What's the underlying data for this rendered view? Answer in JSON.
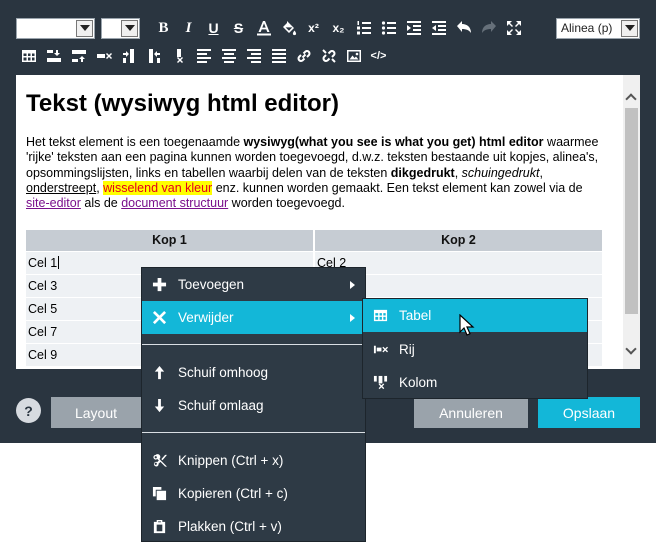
{
  "toolbar": {
    "format_select": {
      "value": "Alinea (p)"
    },
    "font_select": {
      "value": ""
    },
    "size_select": {
      "value": ""
    },
    "bold_label": "B",
    "italic_label": "I",
    "underline_label": "U",
    "strike_label": "S",
    "superscript_label": "x²",
    "subscript_label": "x₂",
    "source_label": "</>"
  },
  "editor": {
    "heading": "Tekst (wysiwyg html editor)",
    "para": {
      "t1": "Het tekst element is een toegenaamde ",
      "b1": "wysiwyg(what you see is what you get) html editor",
      "t2": " waarmee 'rijke' teksten aan een pagina kunnen worden toegevoegd, d.w.z. teksten bestaande uit kopjes, alinea's, opsommingslijsten, links en tabellen waarbij delen van de teksten ",
      "b2": "dikgedrukt",
      "t3": ", ",
      "i1": "schuingedrukt",
      "t4": ", ",
      "u1": "onderstreept",
      "t5": ", ",
      "hl": "wisselend van kleur",
      "t6": " enz. kunnen worden gemaakt. Een tekst element kan zowel via de ",
      "l1": "site-editor",
      "t7": " als de ",
      "l2": "document structuur",
      "t8": " worden toegevoegd."
    },
    "table": {
      "headers": [
        "Kop 1",
        "Kop 2"
      ],
      "rows": [
        [
          "Cel 1",
          "Cel 2"
        ],
        [
          "Cel 3",
          ""
        ],
        [
          "Cel 5",
          ""
        ],
        [
          "Cel 7",
          ""
        ],
        [
          "Cel 9",
          ""
        ]
      ]
    }
  },
  "buttons": {
    "help": "?",
    "layout": "Layout",
    "cancel": "Annuleren",
    "save": "Opslaan"
  },
  "context_menu": {
    "items": [
      {
        "label": "Toevoegen",
        "icon": "plus-icon"
      },
      {
        "label": "Verwijder",
        "icon": "close-icon"
      },
      {
        "label": "Schuif omhoog",
        "icon": "arrow-up-icon"
      },
      {
        "label": "Schuif omlaag",
        "icon": "arrow-down-icon"
      },
      {
        "label": "Knippen (Ctrl + x)",
        "icon": "scissors-icon"
      },
      {
        "label": "Kopieren (Ctrl + c)",
        "icon": "copy-icon"
      },
      {
        "label": "Plakken (Ctrl + v)",
        "icon": "paste-icon"
      }
    ]
  },
  "submenu": {
    "items": [
      {
        "label": "Tabel",
        "icon": "table-icon"
      },
      {
        "label": "Rij",
        "icon": "row-icon"
      },
      {
        "label": "Kolom",
        "icon": "column-icon"
      }
    ]
  },
  "colors": {
    "dialog_bg": "#2a3540",
    "accent": "#13b7d8",
    "menu_bg": "#2e3a45",
    "highlight_bg": "#ffff00",
    "highlight_text": "#e3001b",
    "link": "#7a0f8c"
  }
}
